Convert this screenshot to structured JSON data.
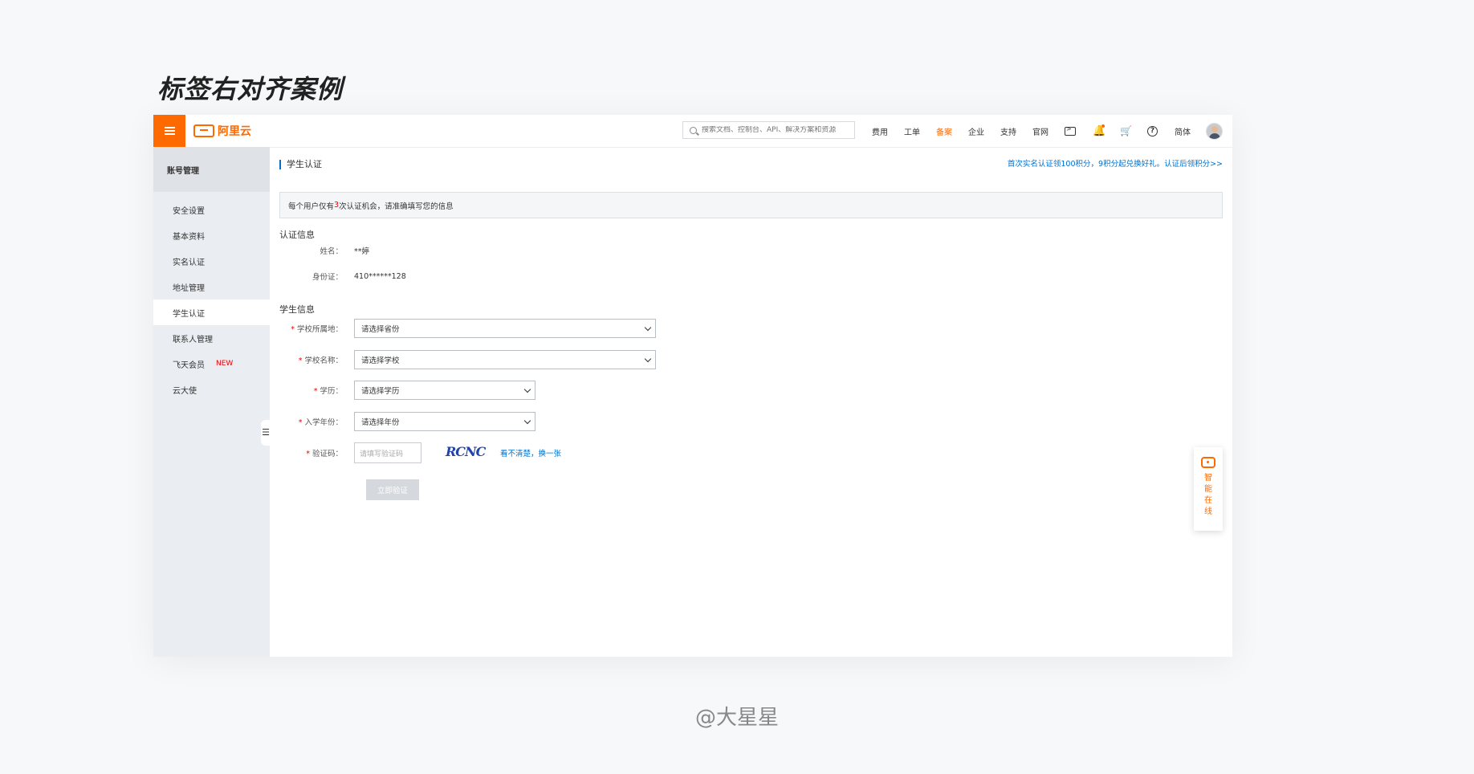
{
  "page_heading": "标签右对齐案例",
  "watermark": "@大星星",
  "topbar": {
    "logo_text": "阿里云",
    "search_placeholder": "搜索文档、控制台、API、解决方案和资源",
    "nav": [
      "费用",
      "工单",
      "备案",
      "企业",
      "支持",
      "官网"
    ],
    "active_nav": "备案",
    "language": "简体"
  },
  "sidebar": {
    "title": "账号管理",
    "items": [
      {
        "label": "安全设置"
      },
      {
        "label": "基本资料"
      },
      {
        "label": "实名认证"
      },
      {
        "label": "地址管理"
      },
      {
        "label": "学生认证"
      },
      {
        "label": "联系人管理"
      },
      {
        "label": "飞天会员",
        "badge": "NEW"
      },
      {
        "label": "云大使"
      }
    ],
    "active": "学生认证",
    "badge_color": "#e00000"
  },
  "main": {
    "title": "学生认证",
    "promo": "首次实名认证领100积分，9积分起兑换好礼。认证后领积分>>",
    "notice_pre": "每个用户仅有",
    "notice_num": "3",
    "notice_post": "次认证机会，请准确填写您的信息",
    "cert_section": "认证信息",
    "name_label": "姓名：",
    "name_value": "**婷",
    "id_label": "身份证：",
    "id_value": "410******128",
    "student_section": "学生信息",
    "school_region_label": "学校所属地：",
    "school_region_value": "请选择省份",
    "school_name_label": "学校名称：",
    "school_name_value": "请选择学校",
    "education_label": "学历：",
    "education_value": "请选择学历",
    "enroll_year_label": "入学年份：",
    "enroll_year_value": "请选择年份",
    "captcha_label": "验证码：",
    "captcha_placeholder": "请填写验证码",
    "captcha_text": "RCNC",
    "refresh_text": "看不清楚，换一张",
    "submit": "立即验证",
    "required_mark": "*"
  },
  "float_help": "智能在线",
  "colors": {
    "accent": "#ff6a00",
    "link": "#0070cc",
    "required": "#e00000"
  }
}
